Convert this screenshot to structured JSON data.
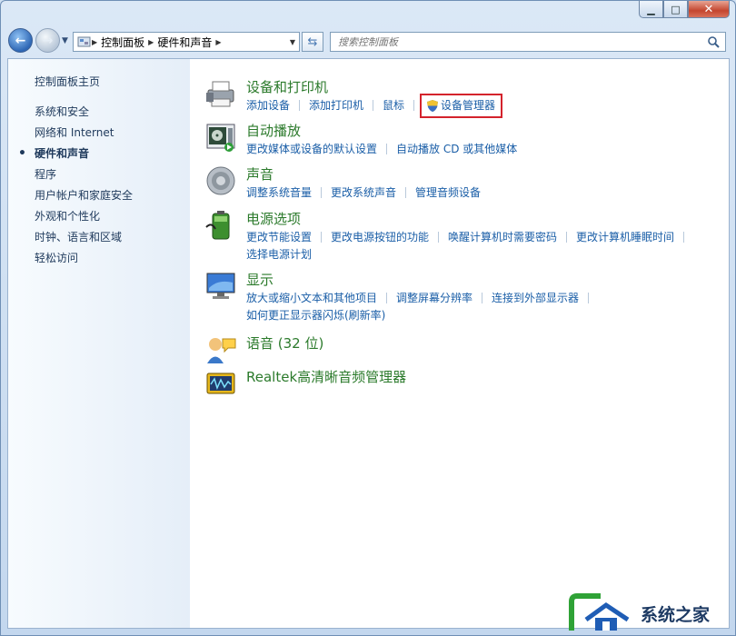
{
  "window": {
    "caption": {
      "minimize": "▁",
      "maximize": "□",
      "close": "✕"
    }
  },
  "toolbar": {
    "breadcrumb": [
      "控制面板",
      "硬件和声音"
    ],
    "search_placeholder": "搜索控制面板"
  },
  "sidebar": {
    "home": "控制面板主页",
    "items": [
      {
        "label": "系统和安全",
        "active": false
      },
      {
        "label": "网络和 Internet",
        "active": false
      },
      {
        "label": "硬件和声音",
        "active": true
      },
      {
        "label": "程序",
        "active": false
      },
      {
        "label": "用户帐户和家庭安全",
        "active": false
      },
      {
        "label": "外观和个性化",
        "active": false
      },
      {
        "label": "时钟、语言和区域",
        "active": false
      },
      {
        "label": "轻松访问",
        "active": false
      }
    ]
  },
  "categories": [
    {
      "title": "设备和打印机",
      "icon": "printer-icon",
      "links": [
        "添加设备",
        "添加打印机",
        "鼠标",
        "设备管理器"
      ]
    },
    {
      "title": "自动播放",
      "icon": "autoplay-icon",
      "links": [
        "更改媒体或设备的默认设置",
        "自动播放 CD 或其他媒体"
      ]
    },
    {
      "title": "声音",
      "icon": "speaker-icon",
      "links": [
        "调整系统音量",
        "更改系统声音",
        "管理音频设备"
      ]
    },
    {
      "title": "电源选项",
      "icon": "battery-icon",
      "links": [
        "更改节能设置",
        "更改电源按钮的功能",
        "唤醒计算机时需要密码",
        "更改计算机睡眠时间",
        "选择电源计划"
      ]
    },
    {
      "title": "显示",
      "icon": "monitor-icon",
      "links": [
        "放大或缩小文本和其他项目",
        "调整屏幕分辨率",
        "连接到外部显示器",
        "如何更正显示器闪烁(刷新率)"
      ]
    },
    {
      "title": "语音 (32 位)",
      "icon": "speech-icon",
      "links": []
    },
    {
      "title": "Realtek高清晰音频管理器",
      "icon": "audio-manager-icon",
      "links": []
    }
  ],
  "watermark": {
    "text": "系统之家"
  },
  "colors": {
    "highlight": "#d4232c",
    "title_green": "#2b7a2b",
    "link_blue": "#1a5ea7"
  }
}
